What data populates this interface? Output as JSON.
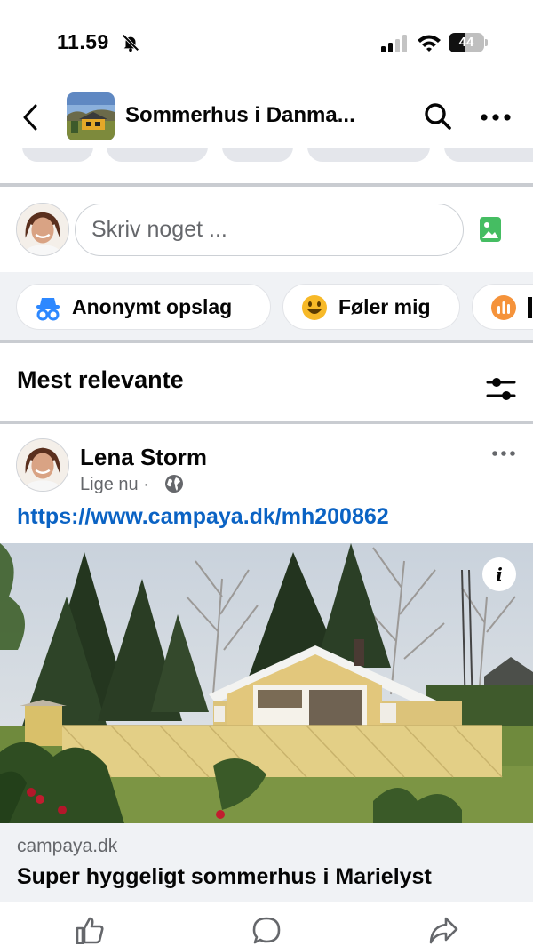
{
  "status_bar": {
    "time": "11.59",
    "battery_level": "44",
    "battery_fraction": 0.44,
    "icons": [
      "bell-slash-icon",
      "signal-icon",
      "wifi-icon",
      "battery-icon"
    ]
  },
  "header": {
    "title": "Sommerhus i Danma...",
    "icons": [
      "back-icon",
      "group-avatar",
      "search-icon",
      "more-icon"
    ]
  },
  "composer": {
    "placeholder": "Skriv noget ...",
    "icons": [
      "profile-avatar",
      "photo-icon"
    ]
  },
  "chips": [
    {
      "label": "Anonymt opslag",
      "icon": "anonymous-icon"
    },
    {
      "label": "Føler mig",
      "icon": "smiley-icon"
    },
    {
      "label": "",
      "icon": "poll-icon"
    }
  ],
  "sort": {
    "label": "Mest relevante",
    "icon": "filter-sliders-icon"
  },
  "post": {
    "author": "Lena Storm",
    "time": "Lige nu",
    "separator": "·",
    "audience_icon": "globe-icon",
    "link_text": "https://www.campaya.dk/mh200862",
    "preview": {
      "domain": "campaya.dk",
      "title": "Super hyggeligt sommerhus i Marielyst",
      "info_badge": "i"
    }
  },
  "actions": [
    {
      "icon": "like-icon"
    },
    {
      "icon": "comment-icon"
    },
    {
      "icon": "share-icon"
    }
  ],
  "colors": {
    "link": "#0b63c4",
    "secondary_text": "#65676b",
    "background_gray": "#f0f2f5",
    "photo_icon_green": "#45bd62",
    "anonymous_icon_blue": "#2d88ff",
    "smiley_yellow": "#f7b928",
    "poll_orange": "#f5933b"
  }
}
